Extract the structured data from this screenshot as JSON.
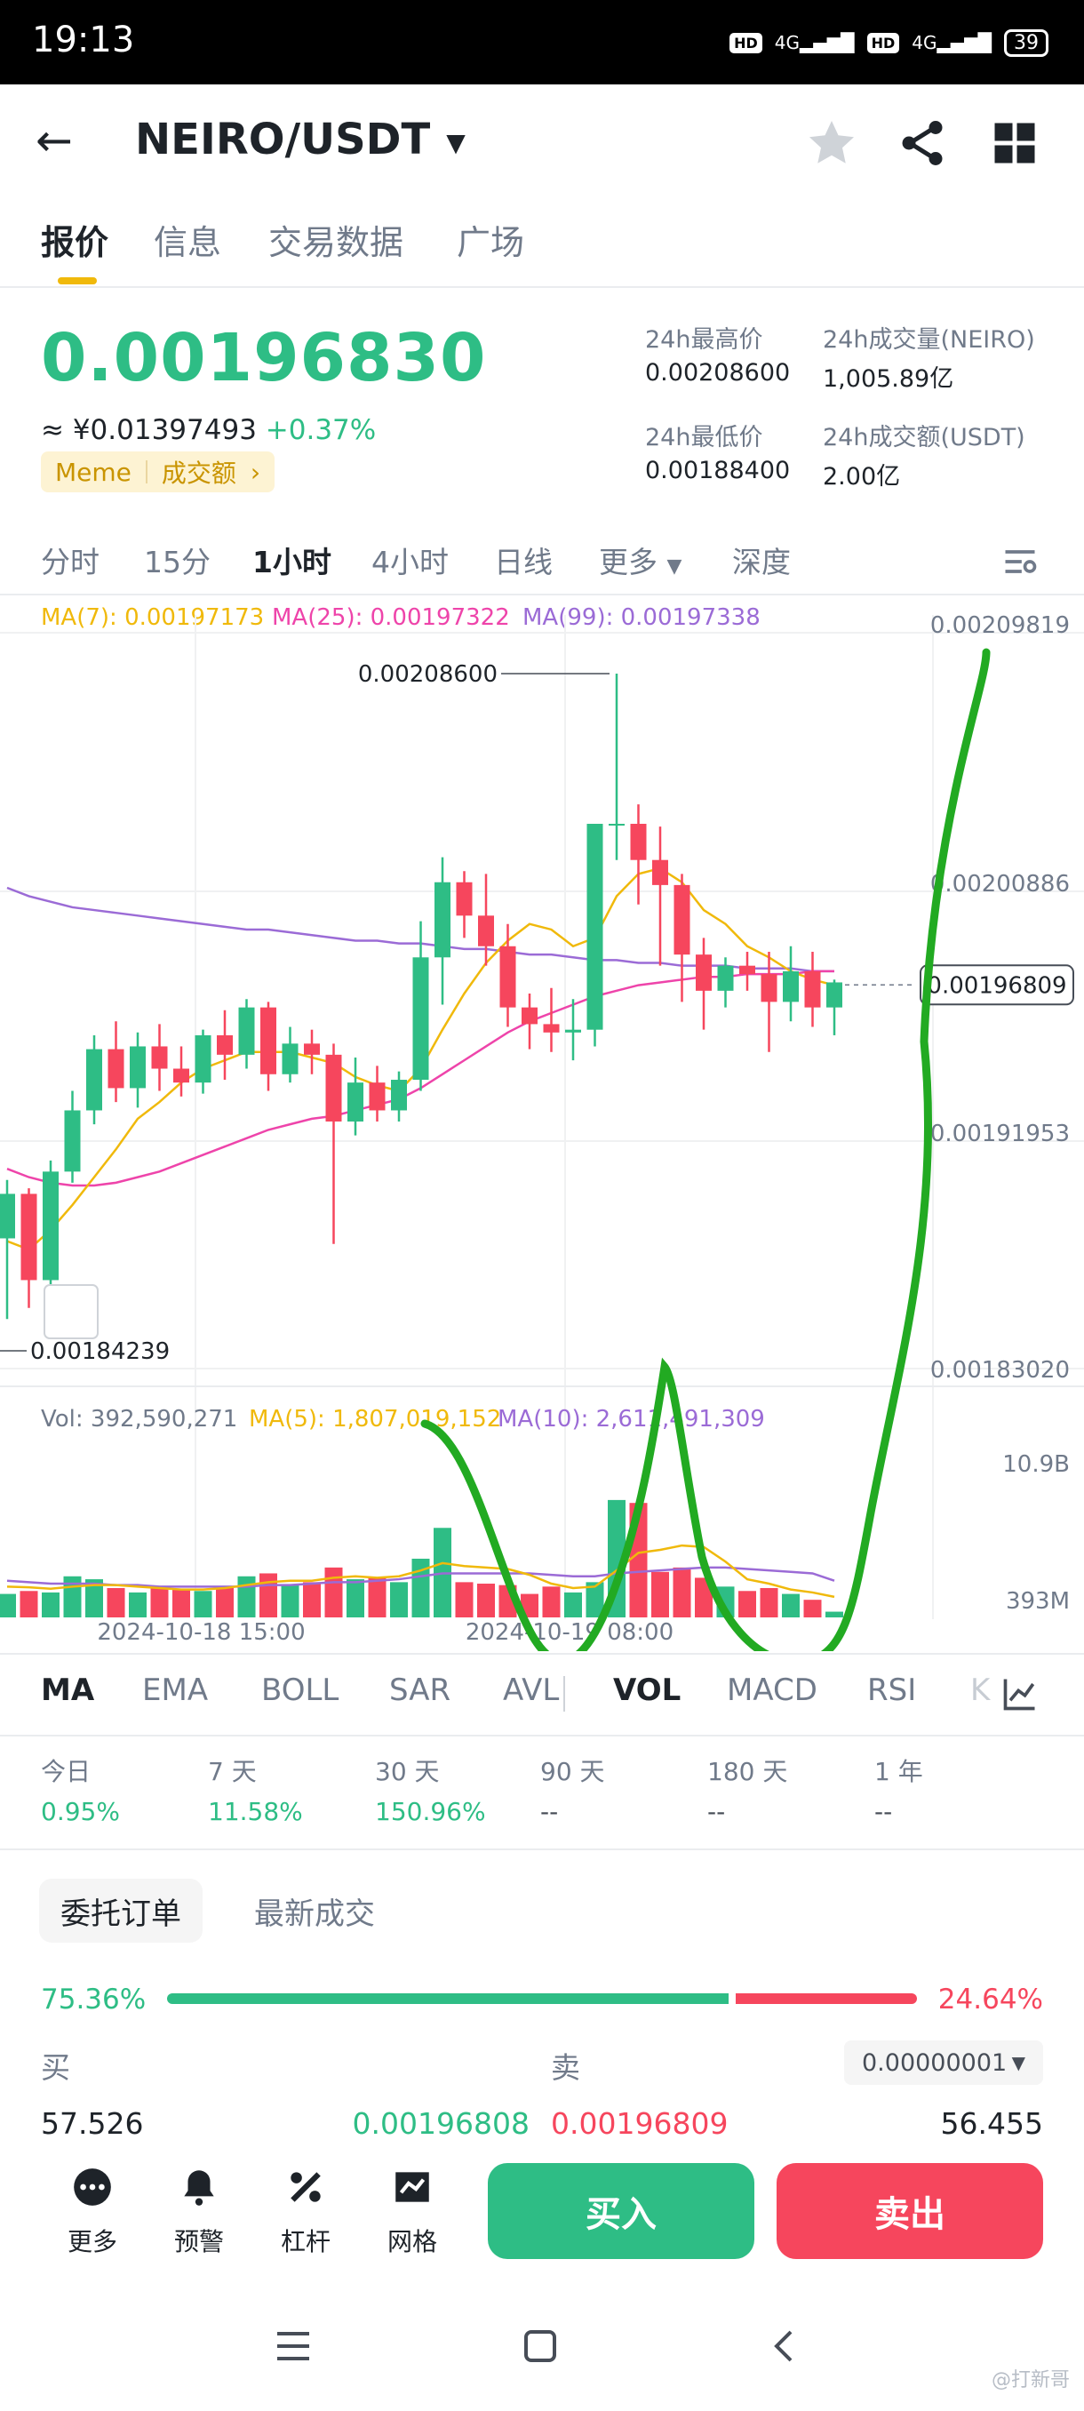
{
  "status": {
    "time": "19:13",
    "hd1": "HD",
    "net1": "4G",
    "hd2": "HD",
    "net2": "4G",
    "battery": "39"
  },
  "header": {
    "pair": "NEIRO/USDT",
    "back_icon": "arrow-left-icon",
    "star_icon": "star-icon",
    "share_icon": "share-icon",
    "grid_icon": "grid-icon"
  },
  "tabs": [
    "报价",
    "信息",
    "交易数据",
    "广场"
  ],
  "ticker": {
    "price": "0.00196830",
    "cny": "≈ ¥0.01397493",
    "change": "+0.37%",
    "tag1": "Meme",
    "tag2": "成交额",
    "high_label": "24h最高价",
    "high": "0.00208600",
    "low_label": "24h最低价",
    "low": "0.00188400",
    "vol_base_label": "24h成交量(NEIRO)",
    "vol_base": "1,005.89亿",
    "vol_quote_label": "24h成交额(USDT)",
    "vol_quote": "2.00亿"
  },
  "periods": [
    "分时",
    "15分",
    "1小时",
    "4小时",
    "日线",
    "更多",
    "深度"
  ],
  "ma_legend": {
    "ma7": "MA(7): 0.00197173",
    "ma25": "MA(25): 0.00197322",
    "ma99": "MA(99): 0.00197338"
  },
  "colors": {
    "up": "#2ebd85",
    "down": "#f6465d",
    "ma7": "#f0b90b",
    "ma25": "#ee44aa",
    "ma99": "#9b6bd6",
    "annotation": "#22aa22"
  },
  "chart_data": {
    "type": "candlestick",
    "interval": "1h",
    "y_ticks": [
      "0.00209819",
      "0.00200886",
      "0.00191953",
      "0.00183020"
    ],
    "ylim": [
      0.0018302,
      0.00209819
    ],
    "high_label": "0.00208600",
    "low_label": "0.00184239",
    "last_price_label": "0.00196809",
    "candles": [
      {
        "o": 0.001877,
        "h": 0.001898,
        "l": 0.001848,
        "c": 0.001893
      },
      {
        "o": 0.001893,
        "h": 0.001895,
        "l": 0.001852,
        "c": 0.001862
      },
      {
        "o": 0.001862,
        "h": 0.001905,
        "l": 0.001857,
        "c": 0.001901
      },
      {
        "o": 0.001901,
        "h": 0.00193,
        "l": 0.001897,
        "c": 0.001923
      },
      {
        "o": 0.001923,
        "h": 0.00195,
        "l": 0.001918,
        "c": 0.001945
      },
      {
        "o": 0.001945,
        "h": 0.001955,
        "l": 0.001926,
        "c": 0.001931
      },
      {
        "o": 0.001931,
        "h": 0.001951,
        "l": 0.001924,
        "c": 0.001946
      },
      {
        "o": 0.001946,
        "h": 0.001954,
        "l": 0.00193,
        "c": 0.001938
      },
      {
        "o": 0.001938,
        "h": 0.001946,
        "l": 0.001928,
        "c": 0.001933
      },
      {
        "o": 0.001933,
        "h": 0.001952,
        "l": 0.001929,
        "c": 0.00195
      },
      {
        "o": 0.00195,
        "h": 0.001959,
        "l": 0.001934,
        "c": 0.001943
      },
      {
        "o": 0.001943,
        "h": 0.001963,
        "l": 0.001938,
        "c": 0.00196
      },
      {
        "o": 0.00196,
        "h": 0.001962,
        "l": 0.00193,
        "c": 0.001936
      },
      {
        "o": 0.001936,
        "h": 0.001953,
        "l": 0.001933,
        "c": 0.001947
      },
      {
        "o": 0.001947,
        "h": 0.001952,
        "l": 0.001936,
        "c": 0.001943
      },
      {
        "o": 0.001943,
        "h": 0.001947,
        "l": 0.001875,
        "c": 0.001919
      },
      {
        "o": 0.001919,
        "h": 0.001942,
        "l": 0.001914,
        "c": 0.001933
      },
      {
        "o": 0.001933,
        "h": 0.001939,
        "l": 0.001919,
        "c": 0.001923
      },
      {
        "o": 0.001923,
        "h": 0.001937,
        "l": 0.001919,
        "c": 0.001934
      },
      {
        "o": 0.001934,
        "h": 0.001991,
        "l": 0.00193,
        "c": 0.001978
      },
      {
        "o": 0.001978,
        "h": 0.002014,
        "l": 0.001961,
        "c": 0.002005
      },
      {
        "o": 0.002005,
        "h": 0.002009,
        "l": 0.001985,
        "c": 0.001993
      },
      {
        "o": 0.001993,
        "h": 0.002008,
        "l": 0.001975,
        "c": 0.001982
      },
      {
        "o": 0.001982,
        "h": 0.00199,
        "l": 0.001953,
        "c": 0.00196
      },
      {
        "o": 0.00196,
        "h": 0.001965,
        "l": 0.001945,
        "c": 0.001954
      },
      {
        "o": 0.001954,
        "h": 0.001967,
        "l": 0.001944,
        "c": 0.001951
      },
      {
        "o": 0.001951,
        "h": 0.001963,
        "l": 0.001941,
        "c": 0.001952
      },
      {
        "o": 0.001952,
        "h": 0.002026,
        "l": 0.001946,
        "c": 0.002026
      },
      {
        "o": 0.002026,
        "h": 0.00208,
        "l": 0.002013,
        "c": 0.002026
      },
      {
        "o": 0.002026,
        "h": 0.002033,
        "l": 0.001997,
        "c": 0.002013
      },
      {
        "o": 0.002013,
        "h": 0.002025,
        "l": 0.001975,
        "c": 0.002004
      },
      {
        "o": 0.002004,
        "h": 0.002008,
        "l": 0.001962,
        "c": 0.001979
      },
      {
        "o": 0.001979,
        "h": 0.001985,
        "l": 0.001952,
        "c": 0.001966
      },
      {
        "o": 0.001966,
        "h": 0.001978,
        "l": 0.00196,
        "c": 0.001975
      },
      {
        "o": 0.001975,
        "h": 0.00198,
        "l": 0.001966,
        "c": 0.001972
      },
      {
        "o": 0.001972,
        "h": 0.00198,
        "l": 0.001944,
        "c": 0.001962
      },
      {
        "o": 0.001962,
        "h": 0.001982,
        "l": 0.001955,
        "c": 0.001973
      },
      {
        "o": 0.001973,
        "h": 0.00198,
        "l": 0.001953,
        "c": 0.00196
      },
      {
        "o": 0.00196,
        "h": 0.00197,
        "l": 0.00195,
        "c": 0.001969
      }
    ],
    "ma7": [
      0.001876,
      0.001873,
      0.00188,
      0.001889,
      0.001899,
      0.001909,
      0.00192,
      0.001926,
      0.001933,
      0.001938,
      0.001941,
      0.001944,
      0.001944,
      0.001944,
      0.001942,
      0.00194,
      0.001935,
      0.001932,
      0.00193,
      0.001938,
      0.001952,
      0.001965,
      0.001976,
      0.001984,
      0.00199,
      0.001988,
      0.001982,
      0.001985,
      0.002,
      0.002008,
      0.00201,
      0.002005,
      0.001995,
      0.00199,
      0.001982,
      0.001978,
      0.001973,
      0.00197,
      0.001968
    ],
    "ma25": [
      0.001902,
      0.001899,
      0.001897,
      0.001896,
      0.001896,
      0.001897,
      0.001899,
      0.001901,
      0.001904,
      0.001907,
      0.00191,
      0.001913,
      0.001916,
      0.001918,
      0.00192,
      0.001921,
      0.001923,
      0.001925,
      0.001927,
      0.001931,
      0.001936,
      0.001941,
      0.001946,
      0.001951,
      0.001955,
      0.001958,
      0.001961,
      0.001964,
      0.001966,
      0.001968,
      0.001969,
      0.00197,
      0.001971,
      0.001971,
      0.001972,
      0.001972,
      0.001972,
      0.001973,
      0.001973
    ],
    "ma99": [
      0.002003,
      0.002,
      0.001998,
      0.001996,
      0.001995,
      0.001994,
      0.001993,
      0.001992,
      0.001991,
      0.00199,
      0.001989,
      0.001988,
      0.001988,
      0.001987,
      0.001986,
      0.001985,
      0.001984,
      0.001984,
      0.001983,
      0.001983,
      0.001982,
      0.001981,
      0.001981,
      0.00198,
      0.001979,
      0.001979,
      0.001978,
      0.001977,
      0.001977,
      0.001976,
      0.001976,
      0.001975,
      0.001975,
      0.001975,
      0.001974,
      0.001974,
      0.001974,
      0.001973,
      0.001973
    ],
    "volume_legend": {
      "vol": "Vol: 392,590,271",
      "ma5": "MA(5): 1,807,019,152",
      "ma10": "MA(10): 2,611,491,309"
    },
    "volume_ticks": [
      "10.9B",
      "393M"
    ],
    "volume": [
      1.6,
      1.8,
      1.7,
      2.8,
      2.6,
      2.0,
      1.7,
      2.0,
      1.9,
      1.8,
      2.0,
      2.8,
      3.0,
      2.2,
      2.4,
      3.4,
      2.6,
      2.7,
      2.4,
      4.0,
      6.1,
      2.4,
      2.3,
      2.2,
      1.6,
      2.1,
      1.7,
      2.4,
      8.0,
      7.8,
      3.1,
      3.4,
      2.7,
      2.1,
      1.8,
      2.0,
      1.6,
      1.2,
      0.39
    ],
    "vol_ma5": [
      2.1,
      2.05,
      1.95,
      2.1,
      2.2,
      2.2,
      2.1,
      2.0,
      1.9,
      1.9,
      2.0,
      2.2,
      2.4,
      2.5,
      2.5,
      2.7,
      2.8,
      2.7,
      2.8,
      3.2,
      3.7,
      3.5,
      3.4,
      3.3,
      2.9,
      2.3,
      2.0,
      2.1,
      3.2,
      4.4,
      4.6,
      4.9,
      4.8,
      3.8,
      2.6,
      2.3,
      1.9,
      1.7,
      1.4
    ],
    "vol_ma10": [
      2.5,
      2.4,
      2.3,
      2.3,
      2.3,
      2.2,
      2.2,
      2.1,
      2.1,
      2.1,
      2.1,
      2.1,
      2.2,
      2.2,
      2.3,
      2.4,
      2.4,
      2.5,
      2.6,
      2.8,
      3.0,
      3.0,
      3.0,
      3.0,
      3.0,
      2.9,
      2.8,
      2.8,
      3.0,
      3.1,
      3.2,
      3.3,
      3.4,
      3.4,
      3.3,
      3.2,
      3.1,
      3.0,
      2.5
    ],
    "x_labels": [
      "2024-10-18 15:00",
      "2024-10-19 08:00"
    ]
  },
  "indicators": [
    "MA",
    "EMA",
    "BOLL",
    "SAR",
    "AVL",
    "VOL",
    "MACD",
    "RSI",
    "K"
  ],
  "performance": [
    {
      "label": "今日",
      "value": "0.95%"
    },
    {
      "label": "7 天",
      "value": "11.58%"
    },
    {
      "label": "30 天",
      "value": "150.96%"
    },
    {
      "label": "90 天",
      "value": "--"
    },
    {
      "label": "180 天",
      "value": "--"
    },
    {
      "label": "1 年",
      "value": "--"
    }
  ],
  "orderbook": {
    "tab_active": "委托订单",
    "tab_inactive": "最新成交",
    "buy_pct": "75.36%",
    "sell_pct": "24.64%",
    "buy_ratio": 0.7536,
    "buy_label": "买",
    "sell_label": "卖",
    "precision": "0.00000001",
    "buy_qty": "57.526",
    "bid": "0.00196808",
    "ask": "0.00196809",
    "sell_qty": "56.455"
  },
  "bottom": {
    "more": "更多",
    "alert": "预警",
    "leverage": "杠杆",
    "grid": "网格",
    "buy": "买入",
    "sell": "卖出"
  },
  "watermark": "@打新哥"
}
